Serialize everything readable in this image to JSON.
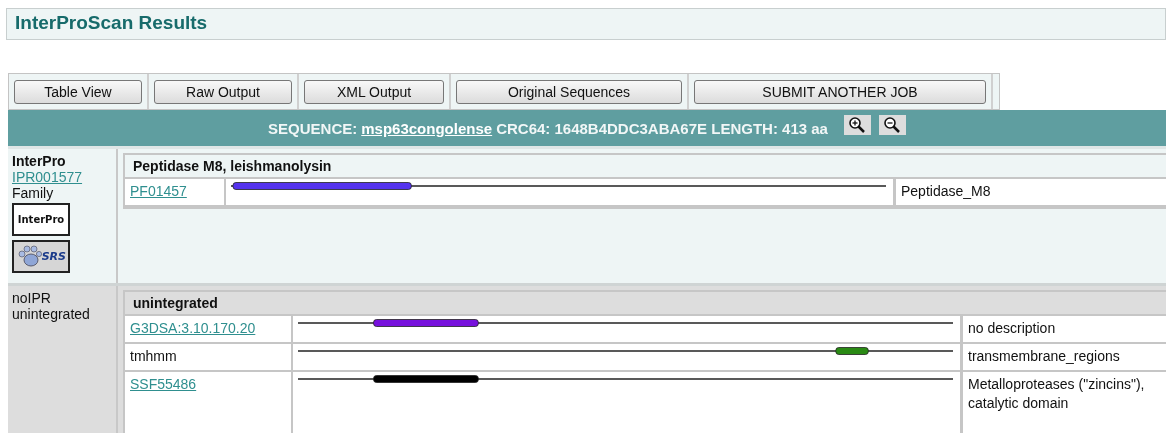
{
  "title": "InterProScan Results",
  "toolbar": [
    "Table View",
    "Raw Output",
    "XML Output",
    "Original Sequences",
    "SUBMIT ANOTHER JOB"
  ],
  "sequence": {
    "label": "SEQUENCE:",
    "name": "msp63congolense",
    "details": "CRC64: 1648B4DDC3ABA67E LENGTH: 413 aa"
  },
  "groups": [
    {
      "kind": "interpro",
      "db": "InterPro",
      "accession": "IPR001577",
      "type": "Family",
      "logos": [
        {
          "kind": "interpro",
          "text": "InterPro"
        },
        {
          "kind": "srs",
          "text": "SRS"
        }
      ],
      "name": "Peptidase M8, leishmanolysin",
      "matches": [
        {
          "accession": "PF01457",
          "linked": true,
          "color": "#5533ee",
          "description": "Peptidase_M8"
        }
      ]
    },
    {
      "kind": "unintegrated",
      "db": "noIPR",
      "type": "unintegrated",
      "name": "unintegrated",
      "matches": [
        {
          "accession": "G3DSA:3.10.170.20",
          "linked": true,
          "color": "#7711dd",
          "description": "no description"
        },
        {
          "accession": "tmhmm",
          "linked": false,
          "color": "#2a8a14",
          "description": "transmembrane_regions"
        },
        {
          "accession": "SSF55486",
          "linked": true,
          "color": "#000000",
          "description": "Metalloproteases (\"zincins\"), catalytic domain"
        }
      ]
    }
  ]
}
